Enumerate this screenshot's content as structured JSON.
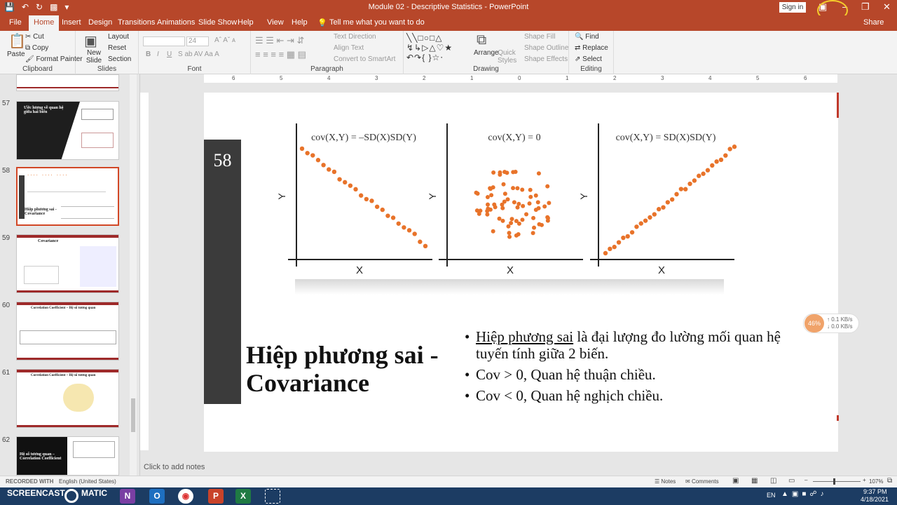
{
  "window": {
    "title": "Module 02 - Descriptive Statistics  -  PowerPoint",
    "signin": "Sign in"
  },
  "tabs": [
    "File",
    "Home",
    "Insert",
    "Design",
    "Transitions",
    "Animations",
    "Slide Show",
    "View",
    "Help"
  ],
  "tell_me": "Tell me what you want to do",
  "share": "Share",
  "ribbon": {
    "clipboard": {
      "label": "Clipboard",
      "paste": "Paste",
      "cut": "Cut",
      "copy": "Copy",
      "format_painter": "Format Painter"
    },
    "slides": {
      "label": "Slides",
      "new_slide": "New Slide",
      "layout": "Layout",
      "reset": "Reset",
      "section": "Section"
    },
    "font": {
      "label": "Font",
      "size": "24"
    },
    "paragraph": {
      "label": "Paragraph",
      "text_direction": "Text Direction",
      "align_text": "Align Text",
      "convert": "Convert to SmartArt"
    },
    "drawing": {
      "label": "Drawing",
      "arrange": "Arrange",
      "quick_styles": "Quick Styles",
      "shape_fill": "Shape Fill",
      "shape_outline": "Shape Outline",
      "shape_effects": "Shape Effects"
    },
    "editing": {
      "label": "Editing",
      "find": "Find",
      "replace": "Replace",
      "select": "Select"
    }
  },
  "thumbnails": [
    {
      "num": "57",
      "title": "Ước lượng về quan hệ giữa hai biến"
    },
    {
      "num": "58",
      "title": "Hiệp phương sai - Covariance"
    },
    {
      "num": "59",
      "title": "Covariance"
    },
    {
      "num": "60",
      "title": "Correlation Coefficient – Hệ số tương quan"
    },
    {
      "num": "61",
      "title": "Correlation Coefficient – Hệ số tương quan"
    },
    {
      "num": "62",
      "title": "Hệ số tương quan – Correlation Coefficient"
    }
  ],
  "slide": {
    "number": "58",
    "title": "Hiệp phương sai - Covariance",
    "bullet1_term": "Hiệp phương sai",
    "bullet1_rest": " là đại lượng đo lường mối quan hệ tuyến tính giữa 2 biến.",
    "bullet2": "Cov > 0, Quan hệ thuận chiều.",
    "bullet3": "Cov < 0, Quan hệ nghịch chiều.",
    "plots": [
      {
        "label": "cov(X,Y) = –SD(X)SD(Y)",
        "xlabel": "X",
        "ylabel": "Y"
      },
      {
        "label": "cov(X,Y) = 0",
        "xlabel": "X",
        "ylabel": "Y"
      },
      {
        "label": "cov(X,Y) = SD(X)SD(Y)",
        "xlabel": "X",
        "ylabel": "Y"
      }
    ]
  },
  "ruler": [
    "6",
    "5",
    "4",
    "3",
    "2",
    "1",
    "0",
    "1",
    "2",
    "3",
    "4",
    "5",
    "6"
  ],
  "notes_placeholder": "Click to add notes",
  "status": {
    "recorded": "RECORDED WITH",
    "language": "English (United States)",
    "notes": "Notes",
    "comments": "Comments",
    "zoom": "107%"
  },
  "net": {
    "percent": "46%",
    "up": "0.1 KB/s",
    "down": "0.0 KB/s"
  },
  "taskbar": {
    "brand": "SCREENCAST",
    "brand2": "MATIC",
    "lang": "EN",
    "time": "9:37 PM",
    "date": "4/18/2021"
  },
  "colors": {
    "accent": "#b7472a",
    "dots": "#e8732a",
    "darkbar": "#3b3b3b"
  }
}
